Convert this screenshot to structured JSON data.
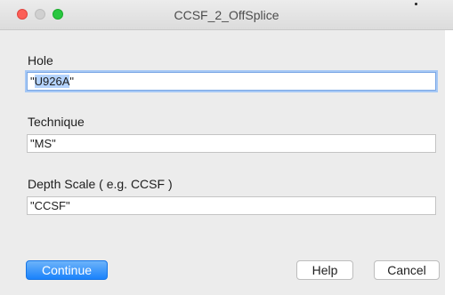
{
  "window": {
    "title": "CCSF_2_OffSplice"
  },
  "fields": {
    "hole": {
      "label": "Hole",
      "value_prefix": "\"",
      "value_selected": "U926A",
      "value_suffix": "\""
    },
    "technique": {
      "label": "Technique",
      "value": "\"MS\""
    },
    "depth_scale": {
      "label": "Depth Scale ( e.g. CCSF )",
      "value": "\"CCSF\""
    }
  },
  "buttons": {
    "continue": "Continue",
    "help": "Help",
    "cancel": "Cancel"
  },
  "colors": {
    "accent": "#1a82fb",
    "selection": "#b4d3fd",
    "close": "#fc5f57",
    "maximize": "#29c740"
  }
}
